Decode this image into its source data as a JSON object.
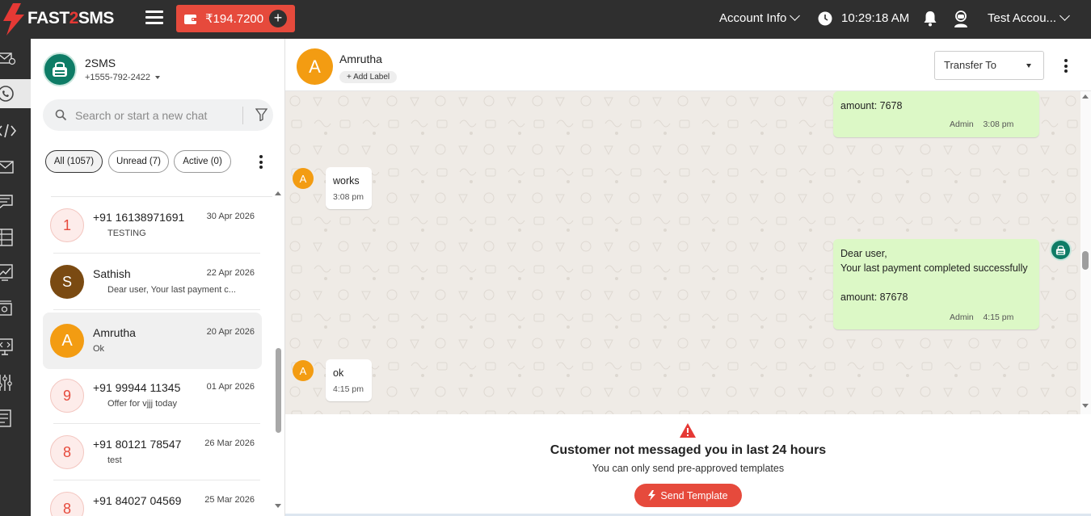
{
  "brand": {
    "name_prefix": "FAST",
    "name_mid": "2",
    "name_suffix": "SMS",
    "accent_color": "#e64a3c"
  },
  "topbar": {
    "wallet_amount": "₹194.7200",
    "account_info_label": "Account Info",
    "time": "10:29:18 AM",
    "user_label": "Test Accou..."
  },
  "sidebar_rail": {
    "items": [
      "mail-settings-icon",
      "whatsapp-icon",
      "code-icon",
      "envelope-icon",
      "chat-icon",
      "server-icon",
      "analytics-icon",
      "money-icon",
      "dev-monitor-icon",
      "sliders-icon",
      "billing-icon"
    ],
    "active": "whatsapp-icon"
  },
  "chat_list": {
    "account_name": "2SMS",
    "account_phone": "+1555-792-2422",
    "search_placeholder": "Search or start a new chat",
    "filters": [
      {
        "label": "All (1057)",
        "active": true
      },
      {
        "label": "Unread (7)",
        "active": false
      },
      {
        "label": "Active (0)",
        "active": false
      }
    ],
    "conversations": [
      {
        "avatar": "1",
        "name": "+91 16138971691",
        "date": "30 Apr 2026",
        "preview": "TESTING",
        "avatar_style": "numeric"
      },
      {
        "avatar": "S",
        "name": "Sathish",
        "date": "22 Apr 2026",
        "preview": "Dear user, Your last payment c...",
        "avatar_style": "brown"
      },
      {
        "avatar": "A",
        "name": "Amrutha",
        "date": "20 Apr 2026",
        "preview": "Ok",
        "avatar_style": "orange",
        "selected": true
      },
      {
        "avatar": "9",
        "name": "+91 99944 11345",
        "date": "01 Apr 2026",
        "preview": "Offer for vjjj today",
        "avatar_style": "numeric"
      },
      {
        "avatar": "8",
        "name": "+91 80121 78547",
        "date": "26 Mar 2026",
        "preview": "test",
        "avatar_style": "numeric"
      },
      {
        "avatar": "8",
        "name": "+91 84027 04569",
        "date": "25 Mar 2026",
        "preview": "",
        "avatar_style": "numeric"
      }
    ]
  },
  "conversation": {
    "avatar": "A",
    "contact_name": "Amrutha",
    "add_label": "Add Label",
    "transfer_label": "Transfer To",
    "messages": [
      {
        "direction": "out",
        "lines": [
          "amount: 7678"
        ],
        "sender": "Admin",
        "time": "3:08 pm"
      },
      {
        "direction": "in",
        "avatar": "A",
        "lines": [
          "works"
        ],
        "time": "3:08 pm"
      },
      {
        "direction": "out",
        "lines": [
          "Dear user,",
          "Your last payment completed successfully",
          "",
          "amount: 87678"
        ],
        "sender": "Admin",
        "time": "4:15 pm"
      },
      {
        "direction": "in",
        "avatar": "A",
        "lines": [
          "ok"
        ],
        "time": "4:15 pm"
      }
    ]
  },
  "footer": {
    "title": "Customer not messaged you in last 24 hours",
    "subtitle": "You can only send pre-approved templates",
    "send_button": "Send Template"
  }
}
